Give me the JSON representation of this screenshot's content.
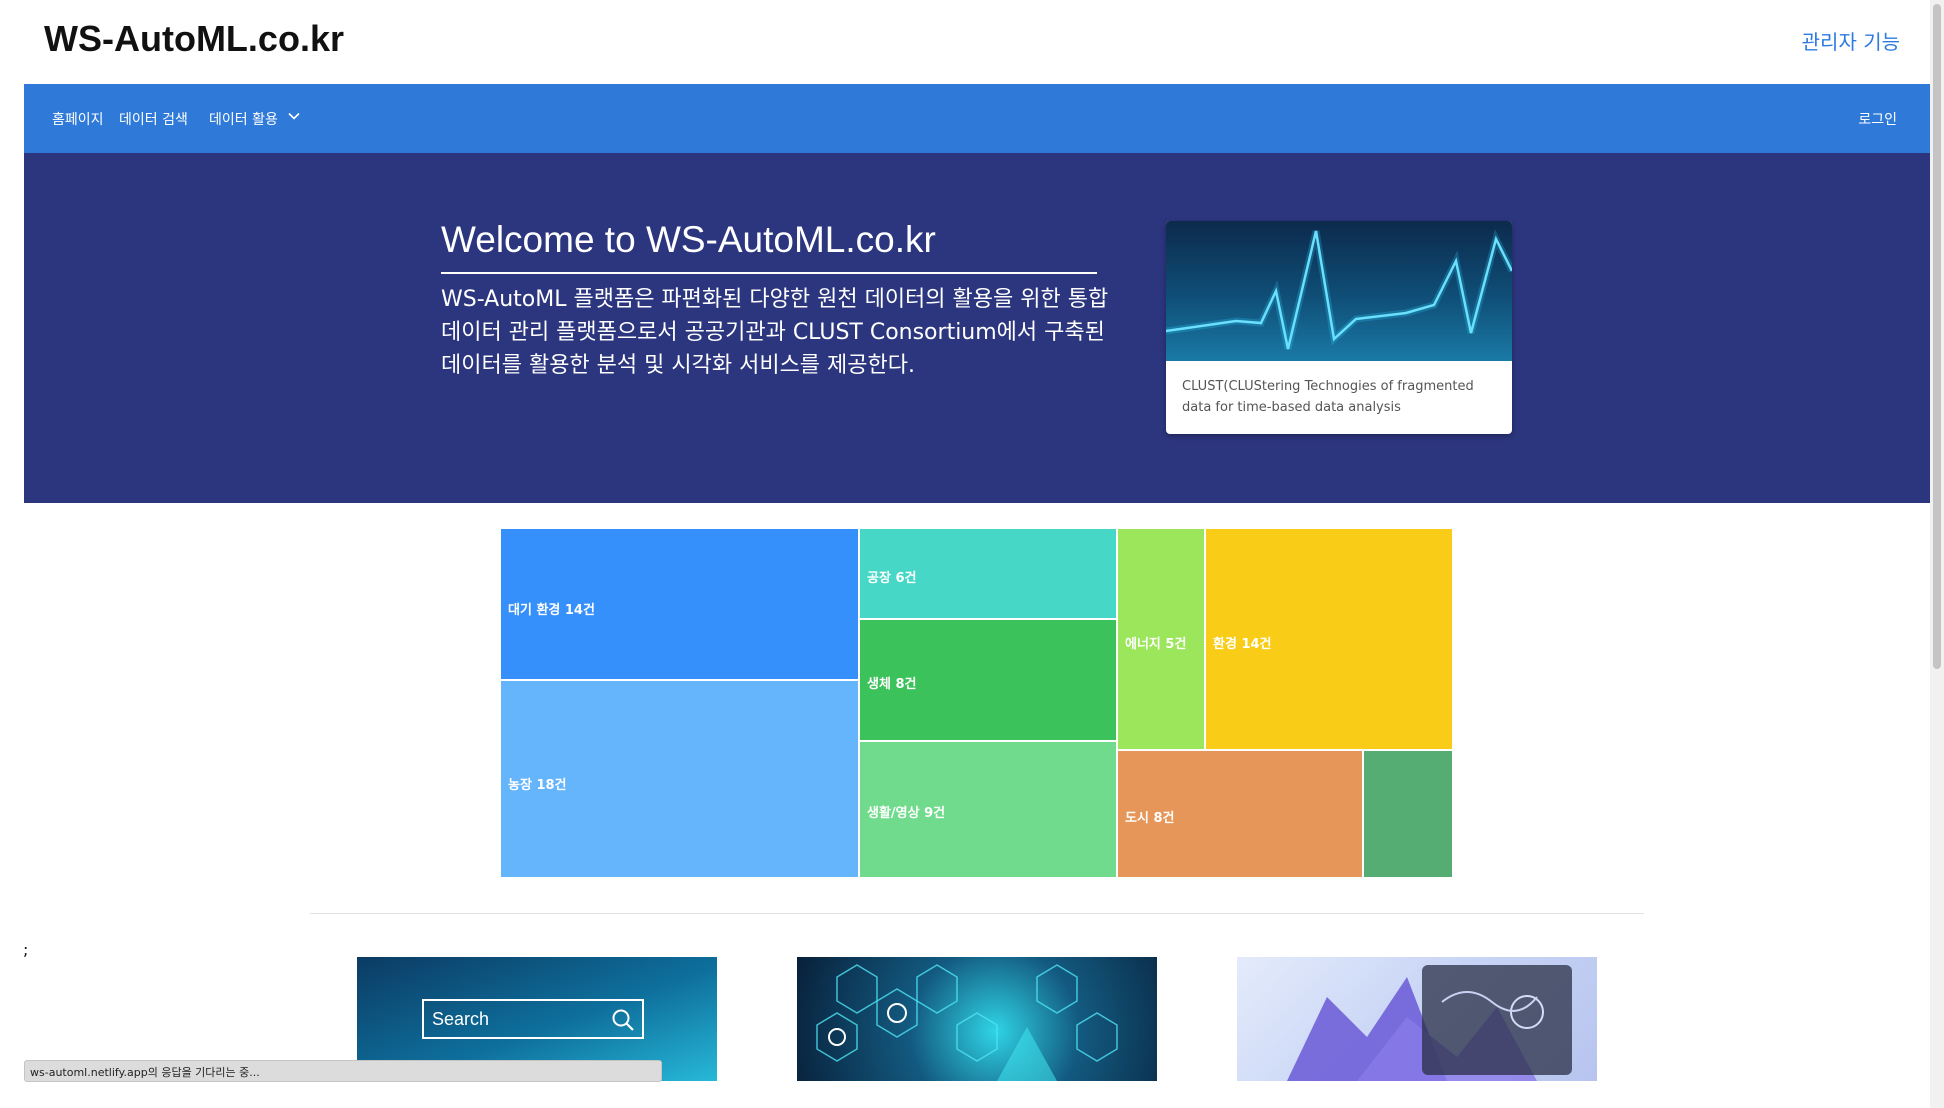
{
  "header": {
    "brand": "WS-AutoML.co.kr",
    "admin_link": "관리자 기능"
  },
  "nav": {
    "items": [
      {
        "label": "홈페이지"
      },
      {
        "label": "데이터 검색"
      },
      {
        "label": "데이터 활용",
        "icon": "chevron-down-icon"
      }
    ],
    "login": "로그인"
  },
  "hero": {
    "title": "Welcome to WS-AutoML.co.kr",
    "description": "WS-AutoML 플랫폼은 파편화된 다양한 원천 데이터의 활용을 위한 통합 데이터 관리 플랫폼으로서 공공기관과 CLUST Consortium에서 구축된 데이터를 활용한 분석 및 시각화 서비스를 제공한다.",
    "card_text": "CLUST(CLUStering Technogies of fragmented data for time-based data analysis"
  },
  "chart_data": {
    "type": "treemap",
    "title": "",
    "tiles": [
      {
        "label": "대기 환경 14건",
        "color": "#3590fc"
      },
      {
        "label": "농장 18건",
        "color": "#64b5fb"
      },
      {
        "label": "공장 6건",
        "color": "#46d7c7"
      },
      {
        "label": "생체 8건",
        "color": "#3cc25a"
      },
      {
        "label": "생활/영상 9건",
        "color": "#70db8c"
      },
      {
        "label": "에너지 5건",
        "color": "#9be65a"
      },
      {
        "label": "환경 14건",
        "color": "#f9cd17"
      },
      {
        "label": "도시 8건",
        "color": "#e69659"
      },
      {
        "label": "",
        "color": "#56ad73"
      }
    ]
  },
  "misc": {
    "semicolon": ";",
    "search_placeholder": "Search",
    "status_text": "ws-automl.netlify.app의 응답을 기다리는 중..."
  }
}
